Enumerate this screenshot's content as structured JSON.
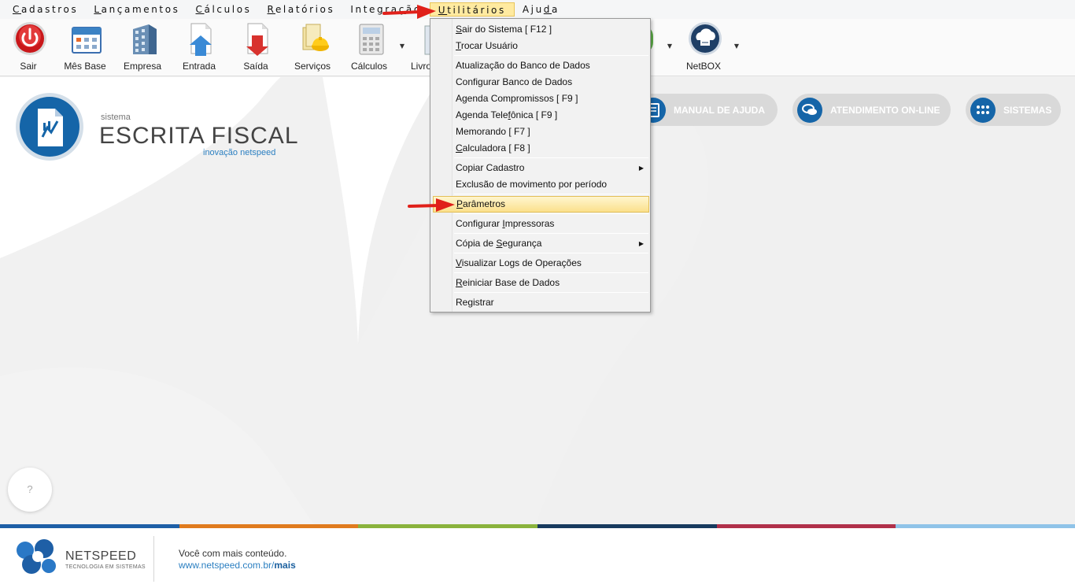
{
  "menubar": {
    "items": [
      {
        "pre": "",
        "key": "C",
        "post": "adastros"
      },
      {
        "pre": "",
        "key": "L",
        "post": "ançamentos"
      },
      {
        "pre": "",
        "key": "C",
        "post": "álculos"
      },
      {
        "pre": "",
        "key": "R",
        "post": "elatórios"
      },
      {
        "pre": "Integra",
        "key": "ç",
        "post": "ão"
      },
      {
        "pre": "",
        "key": "U",
        "post": "tilitários"
      },
      {
        "pre": "Aju",
        "key": "d",
        "post": "a"
      }
    ]
  },
  "toolbar": {
    "items": [
      {
        "label": "Sair",
        "icon": "power-icon"
      },
      {
        "label": "Mês Base",
        "icon": "calendar-icon"
      },
      {
        "label": "Empresa",
        "icon": "building-icon"
      },
      {
        "label": "Entrada",
        "icon": "document-up-icon"
      },
      {
        "label": "Saída",
        "icon": "document-down-icon"
      },
      {
        "label": "Serviços",
        "icon": "services-icon"
      },
      {
        "label": "Cálculos",
        "icon": "calculator-icon"
      },
      {
        "label": "Livro",
        "icon": "book-icon"
      },
      {
        "label": "NetBOX",
        "icon": "netbox-icon"
      }
    ],
    "hidden_label_fragment": "l"
  },
  "logo": {
    "sistema": "sistema",
    "title": "ESCRITA FISCAL",
    "tagline": "inovação netspeed"
  },
  "pills": {
    "manual": "MANUAL DE AJUDA",
    "atendimento": "ATENDIMENTO ON-LINE",
    "sistemas": "SISTEMAS"
  },
  "help": {
    "label": "?"
  },
  "dropdown": {
    "items": [
      {
        "pre": "",
        "key": "S",
        "post": "air do Sistema [ F12 ]"
      },
      {
        "pre": "",
        "key": "T",
        "post": "rocar Usuário"
      },
      {
        "pre": "Atualização do Banco de Dados",
        "key": "",
        "post": ""
      },
      {
        "pre": "Configurar Banco de Dados",
        "key": "",
        "post": ""
      },
      {
        "pre": "Agenda Compromissos [  F9  ]",
        "key": "",
        "post": ""
      },
      {
        "pre": "Agenda Tele",
        "key": "f",
        "post": "ônica [  F9  ]"
      },
      {
        "pre": "Memorando [  F7  ]",
        "key": "",
        "post": ""
      },
      {
        "pre": "",
        "key": "C",
        "post": "alculadora [  F8  ]"
      },
      {
        "pre": "Copiar Cadastro",
        "key": "",
        "post": ""
      },
      {
        "pre": "Exclusão de movimento por período",
        "key": "",
        "post": ""
      },
      {
        "pre": "",
        "key": "P",
        "post": "arâmetros"
      },
      {
        "pre": "Configurar ",
        "key": "I",
        "post": "mpressoras"
      },
      {
        "pre": "Cópia de ",
        "key": "S",
        "post": "egurança"
      },
      {
        "pre": "",
        "key": "V",
        "post": "isualizar Logs de Operações"
      },
      {
        "pre": "",
        "key": "R",
        "post": "einiciar Base de Dados"
      },
      {
        "pre": "Registrar",
        "key": "",
        "post": ""
      }
    ],
    "highlighted_index": 10
  },
  "footer": {
    "brand": "NETSPEED",
    "brand_sub": "TECNOLOGIA EM SISTEMAS",
    "text": "Você com mais conteúdo.",
    "link_prefix": "www.netspeed.com.br/",
    "link_suffix": "mais"
  },
  "colors": {
    "brand_blue": "#1565a8",
    "colorbar": [
      "#1e5fa6",
      "#e07b1e",
      "#8ab33d",
      "#173a5e",
      "#b0304a",
      "#8fc3e8"
    ]
  }
}
